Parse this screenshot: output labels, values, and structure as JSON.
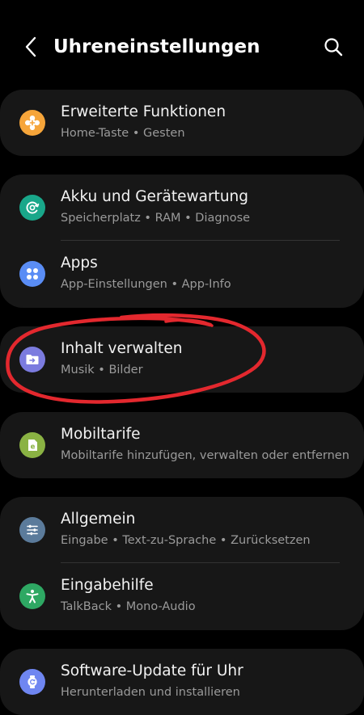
{
  "header": {
    "title": "Uhreneinstellungen"
  },
  "colors": {
    "background": "#000000",
    "card": "#171717",
    "annotation_stroke": "#e3282e"
  },
  "icons": {
    "back": "chevron-left-icon",
    "search": "search-icon"
  },
  "groups": [
    {
      "items": [
        {
          "label": "Erweiterte Funktionen",
          "sub": "Home-Taste • Gesten",
          "icon": "gear-plus-icon",
          "color": "#f6a53a"
        }
      ]
    },
    {
      "items": [
        {
          "label": "Akku und Gerätewartung",
          "sub": "Speicherplatz • RAM • Diagnose",
          "icon": "device-care-icon",
          "color": "#19a78a"
        },
        {
          "label": "Apps",
          "sub": "App-Einstellungen • App-Info",
          "icon": "apps-grid-icon",
          "color": "#5a8df5"
        }
      ]
    },
    {
      "items": [
        {
          "label": "Inhalt verwalten",
          "sub": "Musik • Bilder",
          "icon": "folder-transfer-icon",
          "color": "#7b7bdf"
        }
      ]
    },
    {
      "items": [
        {
          "label": "Mobiltarife",
          "sub": "Mobiltarife hinzufügen, verwalten oder entfernen",
          "icon": "esim-icon",
          "color": "#8ab243"
        }
      ]
    },
    {
      "items": [
        {
          "label": "Allgemein",
          "sub": "Eingabe • Text-zu-Sprache • Zurücksetzen",
          "icon": "sliders-icon",
          "color": "#5b7b9b"
        },
        {
          "label": "Eingabehilfe",
          "sub": "TalkBack • Mono-Audio",
          "icon": "accessibility-icon",
          "color": "#2ea863"
        }
      ]
    },
    {
      "items": [
        {
          "label": "Software-Update für Uhr",
          "sub": "Herunterladen und installieren",
          "icon": "watch-update-icon",
          "color": "#6f86f1"
        }
      ]
    }
  ]
}
